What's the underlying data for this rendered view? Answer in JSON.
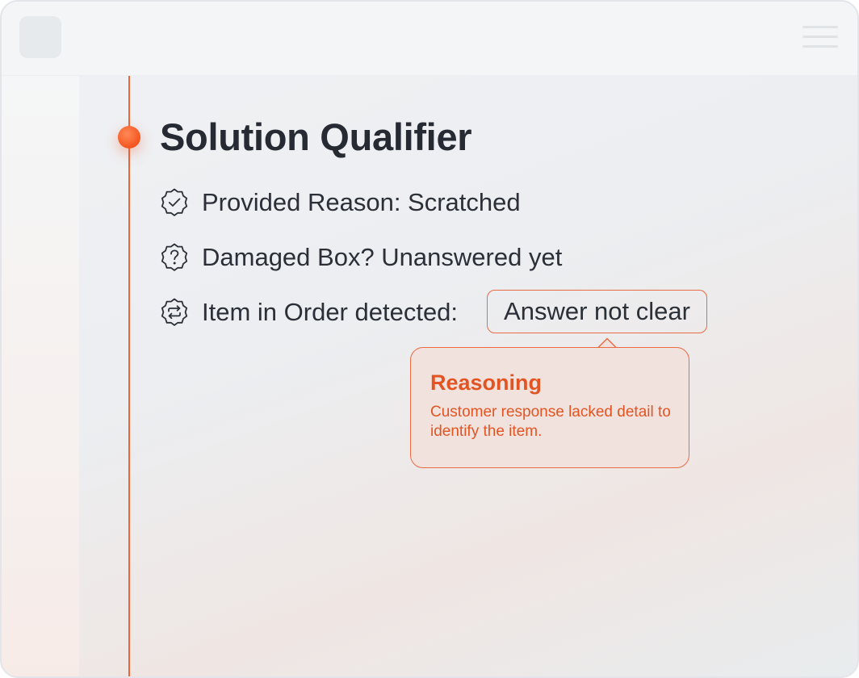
{
  "colors": {
    "accent": "#f06438",
    "tooltip_text": "#e25523",
    "tooltip_bg": "#f2e2de",
    "text": "#2a2f38"
  },
  "panel": {
    "title": "Solution Qualifier",
    "items": [
      {
        "icon": "badge-check-icon",
        "text": "Provided Reason: Scratched"
      },
      {
        "icon": "badge-question-icon",
        "text": "Damaged Box? Unanswered yet"
      },
      {
        "icon": "badge-repeat-icon",
        "label": "Item in Order detected:",
        "value": "Answer not clear"
      }
    ]
  },
  "tooltip": {
    "title": "Reasoning",
    "text": "Customer response lacked detail to identify the item."
  }
}
